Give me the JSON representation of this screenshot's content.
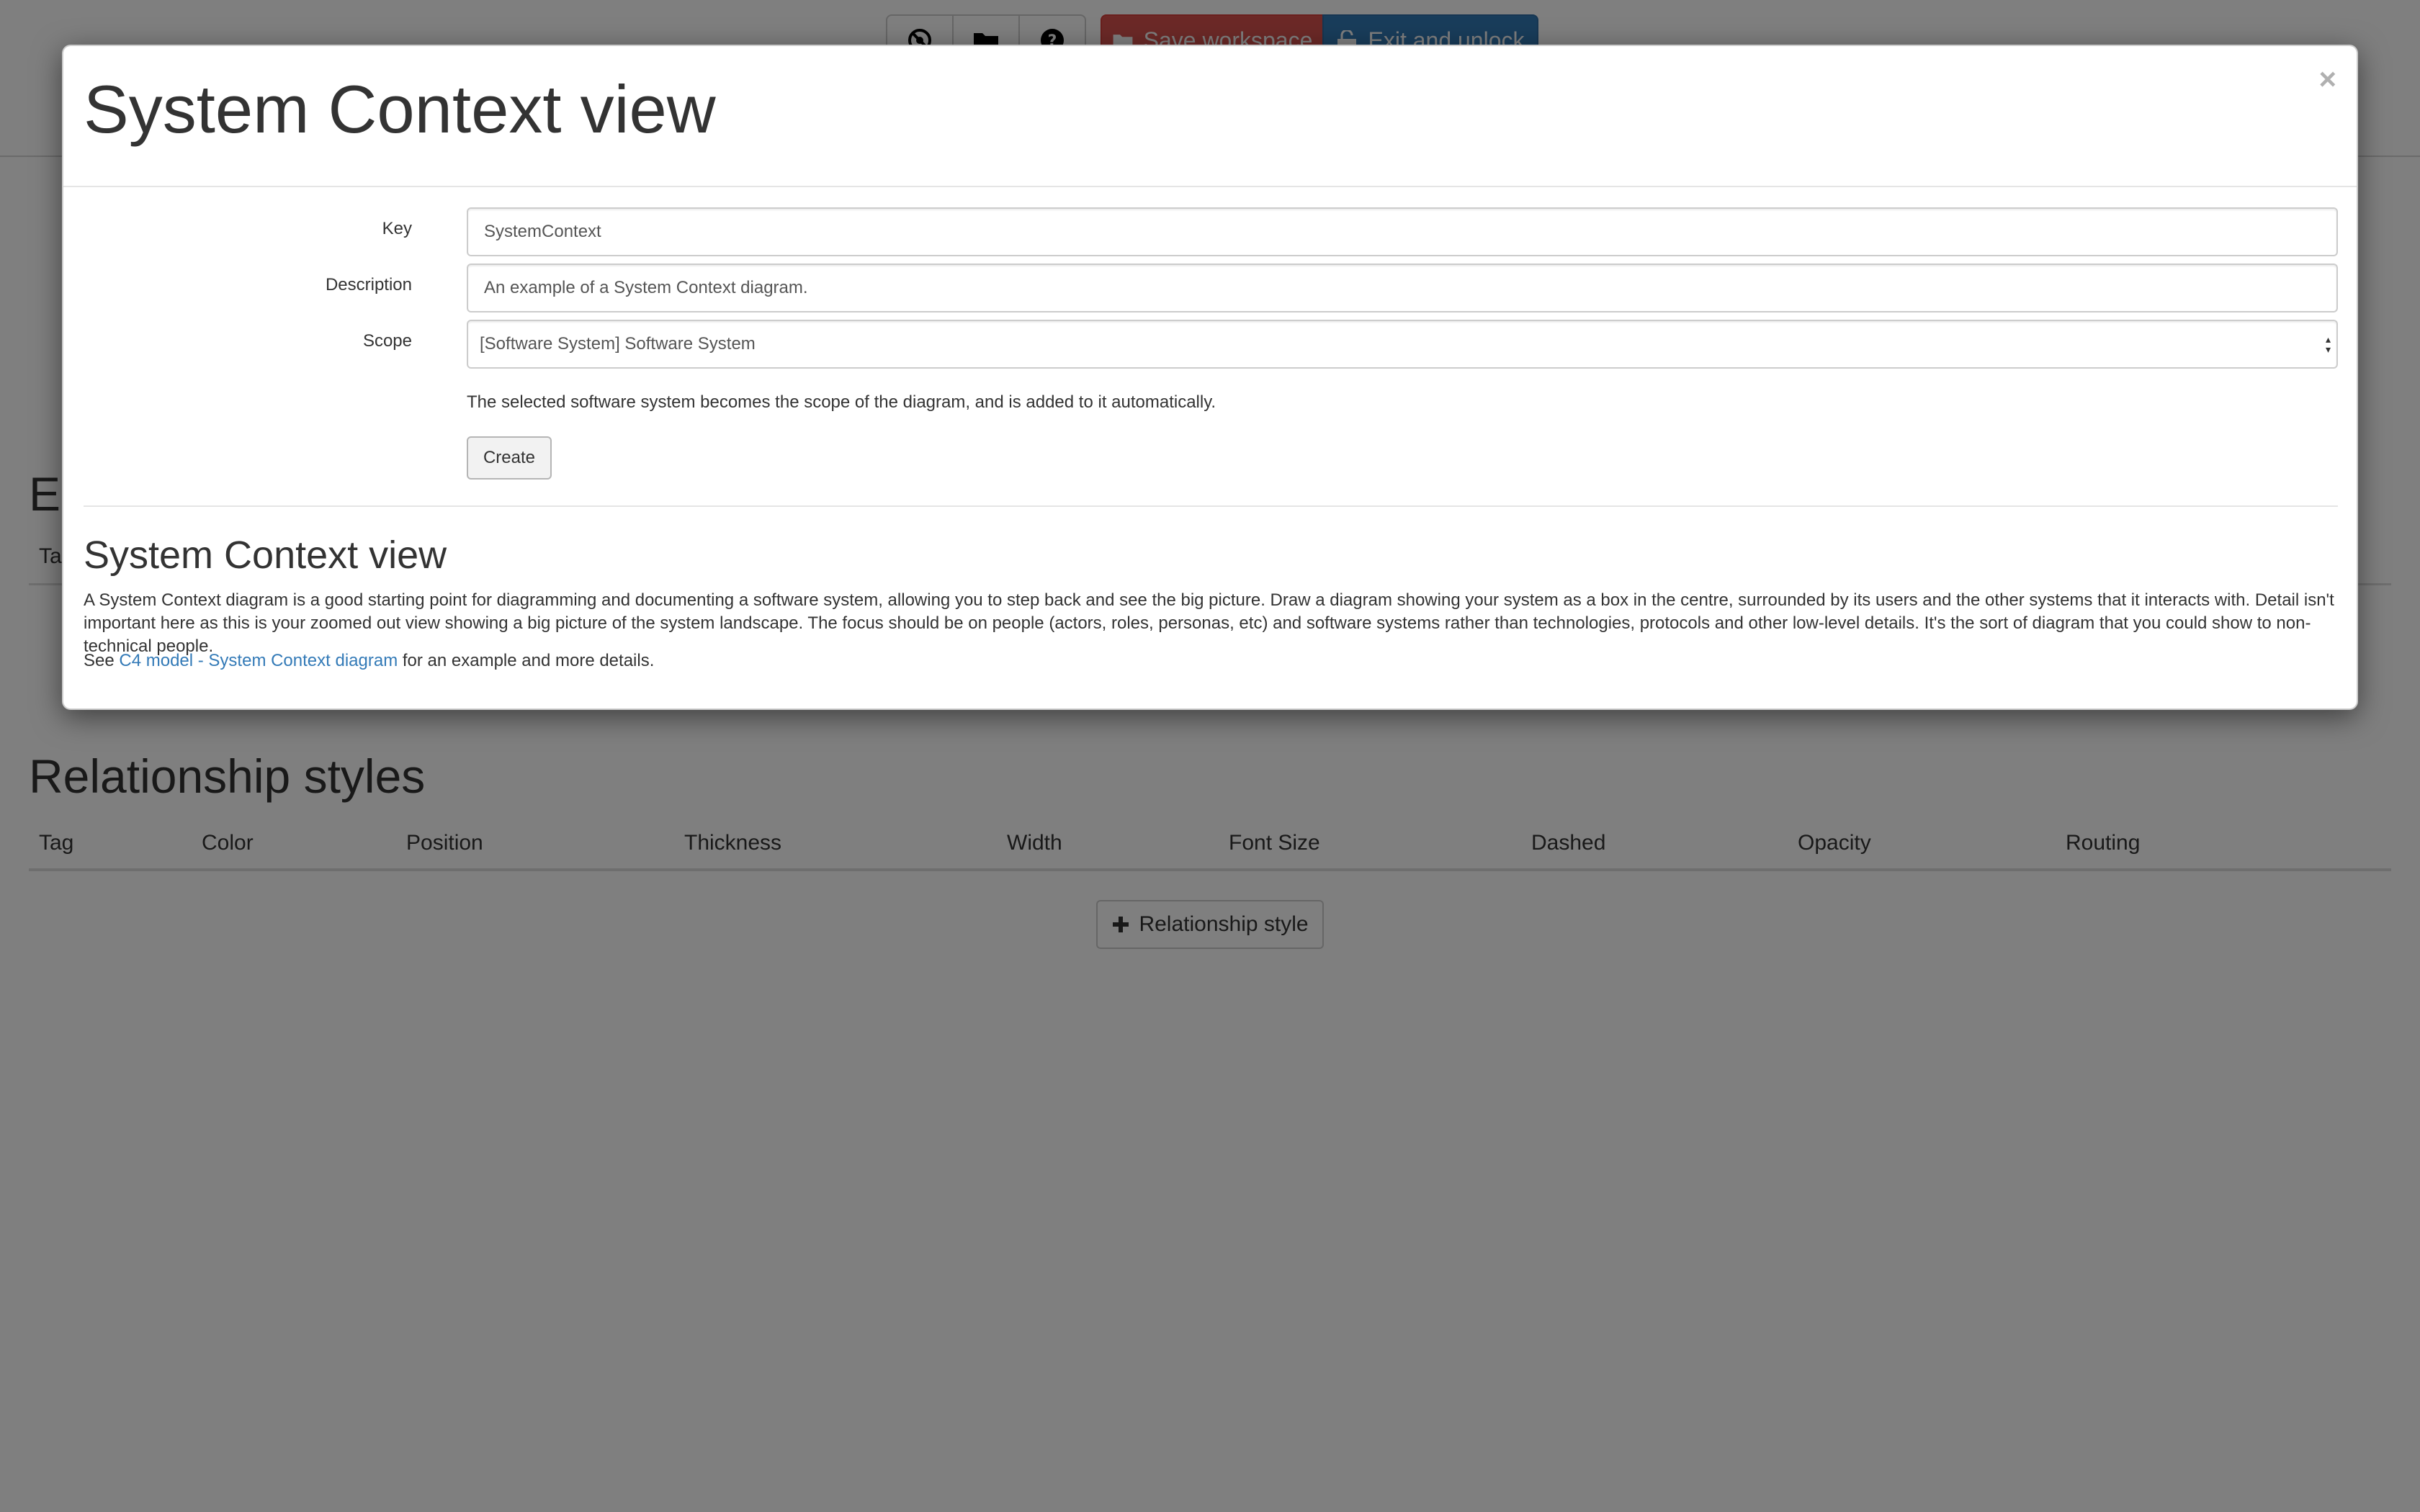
{
  "toolbar": {
    "save_label": "Save workspace",
    "exit_label": "Exit and unlock"
  },
  "background": {
    "elements_heading_partial": "El",
    "elements_th_partial": "Ta",
    "relationship_heading": "Relationship styles",
    "relationship_columns": [
      "Tag",
      "Color",
      "Position",
      "Thickness",
      "Width",
      "Font Size",
      "Dashed",
      "Opacity",
      "Routing"
    ],
    "add_relationship_label": "Relationship style"
  },
  "modal": {
    "title": "System Context view",
    "close_symbol": "×",
    "form": {
      "key_label": "Key",
      "key_value": "SystemContext",
      "description_label": "Description",
      "description_value": "An example of a System Context diagram.",
      "scope_label": "Scope",
      "scope_value": "[Software System] Software System",
      "help_text": "The selected software system becomes the scope of the diagram, and is added to it automatically.",
      "create_label": "Create"
    },
    "doc": {
      "heading": "System Context view",
      "paragraph": "A System Context diagram is a good starting point for diagramming and documenting a software system, allowing you to step back and see the big picture. Draw a diagram showing your system as a box in the centre, surrounded by its users and the other systems that it interacts with. Detail isn't important here as this is your zoomed out view showing a big picture of the system landscape. The focus should be on people (actors, roles, personas, etc) and software systems rather than technologies, protocols and other low-level details. It's the sort of diagram that you could show to non-technical people.",
      "see_prefix": "See ",
      "link_text": "C4 model - System Context diagram",
      "see_suffix": " for an example and more details."
    }
  },
  "colors": {
    "save_button": "#d9534f",
    "exit_button": "#337ab7",
    "link": "#337ab7",
    "backdrop": "#000000"
  },
  "icons": {
    "toolbar": [
      "settings-icon",
      "folder-icon",
      "help-icon"
    ],
    "save": "folder-icon",
    "exit": "unlock-icon",
    "add": "plus-icon"
  }
}
